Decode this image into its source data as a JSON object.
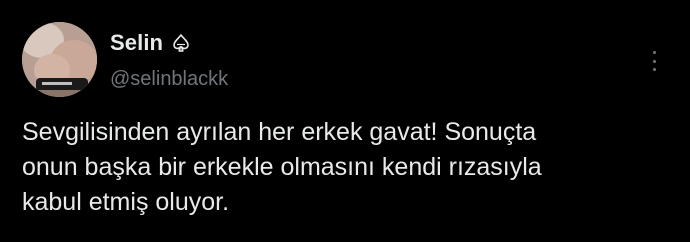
{
  "tweet": {
    "display_name": "Selin",
    "handle": "@selinblackk",
    "text": "Sevgilisinden ayrılan her erkek gavat! Sonuçta\nonun başka bir erkekle olmasını kendi rızasıyla\nkabul etmiş oluyor.",
    "badge_icon": "spade-icon",
    "more_icon": "more-options-icon"
  },
  "colors": {
    "background": "#000000",
    "primary_text": "#e7e9ea",
    "secondary_text": "#71767b"
  }
}
